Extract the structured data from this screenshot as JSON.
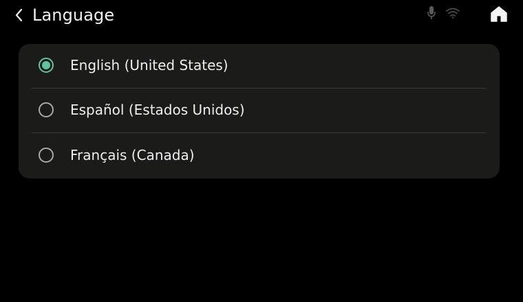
{
  "header": {
    "title": "Language",
    "back_icon": "chevron-left-icon",
    "status_icons": [
      "microphone-icon",
      "wifi-icon"
    ],
    "home_icon": "home-icon"
  },
  "languages": [
    {
      "label": "English (United States)",
      "selected": true
    },
    {
      "label": "Español (Estados Unidos)",
      "selected": false
    },
    {
      "label": "Français (Canada)",
      "selected": false
    }
  ],
  "colors": {
    "background": "#000000",
    "card": "#1b1b19",
    "accent": "#5cc69c",
    "text": "#eeeeee",
    "radio_unselected": "#a9aaa5"
  }
}
